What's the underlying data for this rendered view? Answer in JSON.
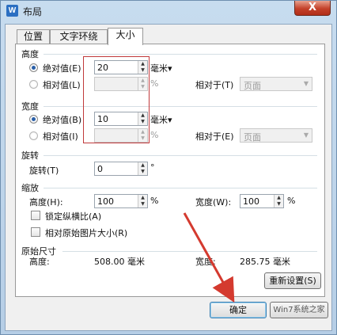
{
  "window": {
    "title": "布局",
    "icon": "W",
    "close_label": "X"
  },
  "tabs": [
    {
      "label": "位置"
    },
    {
      "label": "文字环绕"
    },
    {
      "label": "大小"
    }
  ],
  "height_group": {
    "title": "高度",
    "absolute": {
      "label": "绝对值(E)",
      "value": "20",
      "unit": "毫米▾"
    },
    "relative": {
      "label": "相对值(L)",
      "value": "",
      "unit": "%",
      "relative_to_label": "相对于(T)",
      "relative_to_value": "页面"
    }
  },
  "width_group": {
    "title": "宽度",
    "absolute": {
      "label": "绝对值(B)",
      "value": "10",
      "unit": "毫米▾"
    },
    "relative": {
      "label": "相对值(I)",
      "value": "",
      "unit": "%",
      "relative_to_label": "相对于(E)",
      "relative_to_value": "页面"
    }
  },
  "rotate_group": {
    "title": "旋转",
    "label": "旋转(T)",
    "value": "0",
    "unit": "°"
  },
  "scale_group": {
    "title": "缩放",
    "height_label": "高度(H):",
    "height_value": "100",
    "width_label": "宽度(W):",
    "width_value": "100",
    "unit": "%",
    "lock_ratio": "锁定纵横比(A)",
    "relative_original": "相对原始图片大小(R)"
  },
  "original_group": {
    "title": "原始尺寸",
    "height_label": "高度:",
    "height_value": "508.00 毫米",
    "width_label": "宽度:",
    "width_value": "285.75 毫米",
    "reset_button": "重新设置(S)"
  },
  "footer": {
    "ok_button": "确定",
    "watermark": "Win7系统之家"
  },
  "colors": {
    "annotation": "#d43a2f",
    "title_bar": "#c7dcef"
  }
}
